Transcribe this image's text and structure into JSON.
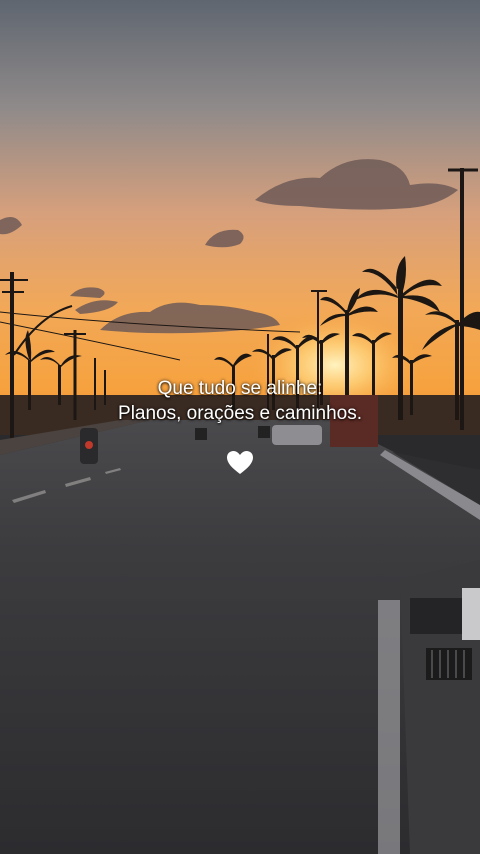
{
  "caption": {
    "line1": "Que tudo se alinhe:",
    "line2": "Planos, orações e caminhos."
  },
  "heart_icon": "white-heart-icon",
  "colors": {
    "sky_top": "#5f6670",
    "sky_horizon": "#f6a23f",
    "road": "#3a3a3d",
    "caption_text": "#ffffff"
  }
}
